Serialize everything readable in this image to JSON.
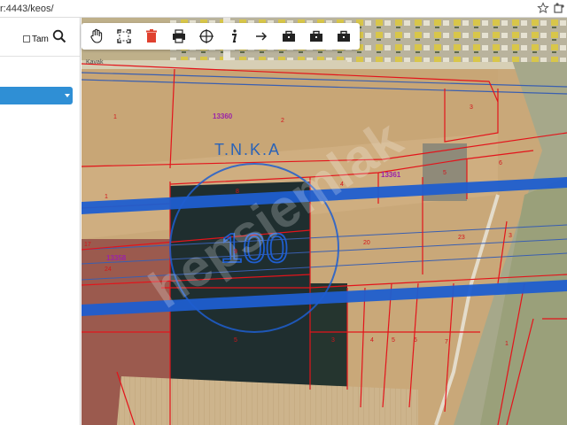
{
  "browser": {
    "url": "r:4443/keos/",
    "icons": [
      "star-icon",
      "extension-icon"
    ]
  },
  "left_panel": {
    "tam_label": "Tam",
    "tam_checked": false,
    "search_icon": "search-icon",
    "layer_select_color": "#2f8fd5"
  },
  "toolbar": {
    "tools": [
      "pan-hand-icon",
      "zoom-extent-icon",
      "delete-trash-icon",
      "print-icon",
      "coordinate-crosshair-icon",
      "info-icon",
      "arrow-right-icon",
      "briefcase-icon",
      "briefcase-icon",
      "briefcase-icon"
    ]
  },
  "map": {
    "corner_label": "Kavak",
    "title_label": "T.N.K.A",
    "scale_circle_label": "100",
    "watermark": "hepsiemlak",
    "parcel_numbers": {
      "p13360": "13360",
      "p13361": "13361",
      "p13358": "13358"
    },
    "lot_numbers": [
      "1",
      "2",
      "3",
      "4",
      "5",
      "6",
      "7",
      "8",
      "9",
      "10",
      "17",
      "20",
      "23",
      "24",
      "25"
    ],
    "colors": {
      "parcel_line": "#e3141b",
      "parcel_number": "#9b22a8",
      "lot_number": "#d4141b",
      "tnka_text": "#2a63b8",
      "pipeline": "#1f5ecf",
      "field_dry": "#c9a879",
      "field_dark": "#1f2e2f"
    }
  }
}
